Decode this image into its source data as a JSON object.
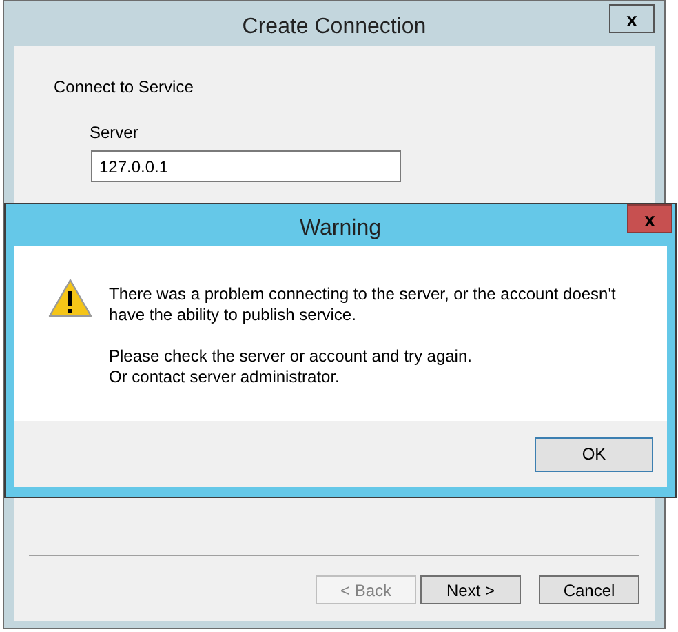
{
  "window": {
    "title": "Create Connection",
    "close": "x"
  },
  "section_title": "Connect to Service",
  "server": {
    "label": "Server",
    "value": "127.0.0.1"
  },
  "buttons": [
    {
      "label": "< Back",
      "disabled": true
    },
    {
      "label": "Next >",
      "disabled": false
    },
    {
      "label": "Cancel",
      "disabled": false
    }
  ],
  "warning_dialog": {
    "title": "Warning",
    "close": "x",
    "paragraphs": [
      {
        "lines": [
          "There was a problem connecting to the server, or the account doesn't",
          "have the ability to publish service."
        ]
      },
      {
        "lines": [
          "Please check the server or account and try again.",
          "Or contact server administrator."
        ]
      }
    ],
    "buttons": [
      {
        "label": "OK",
        "default": true
      }
    ]
  }
}
